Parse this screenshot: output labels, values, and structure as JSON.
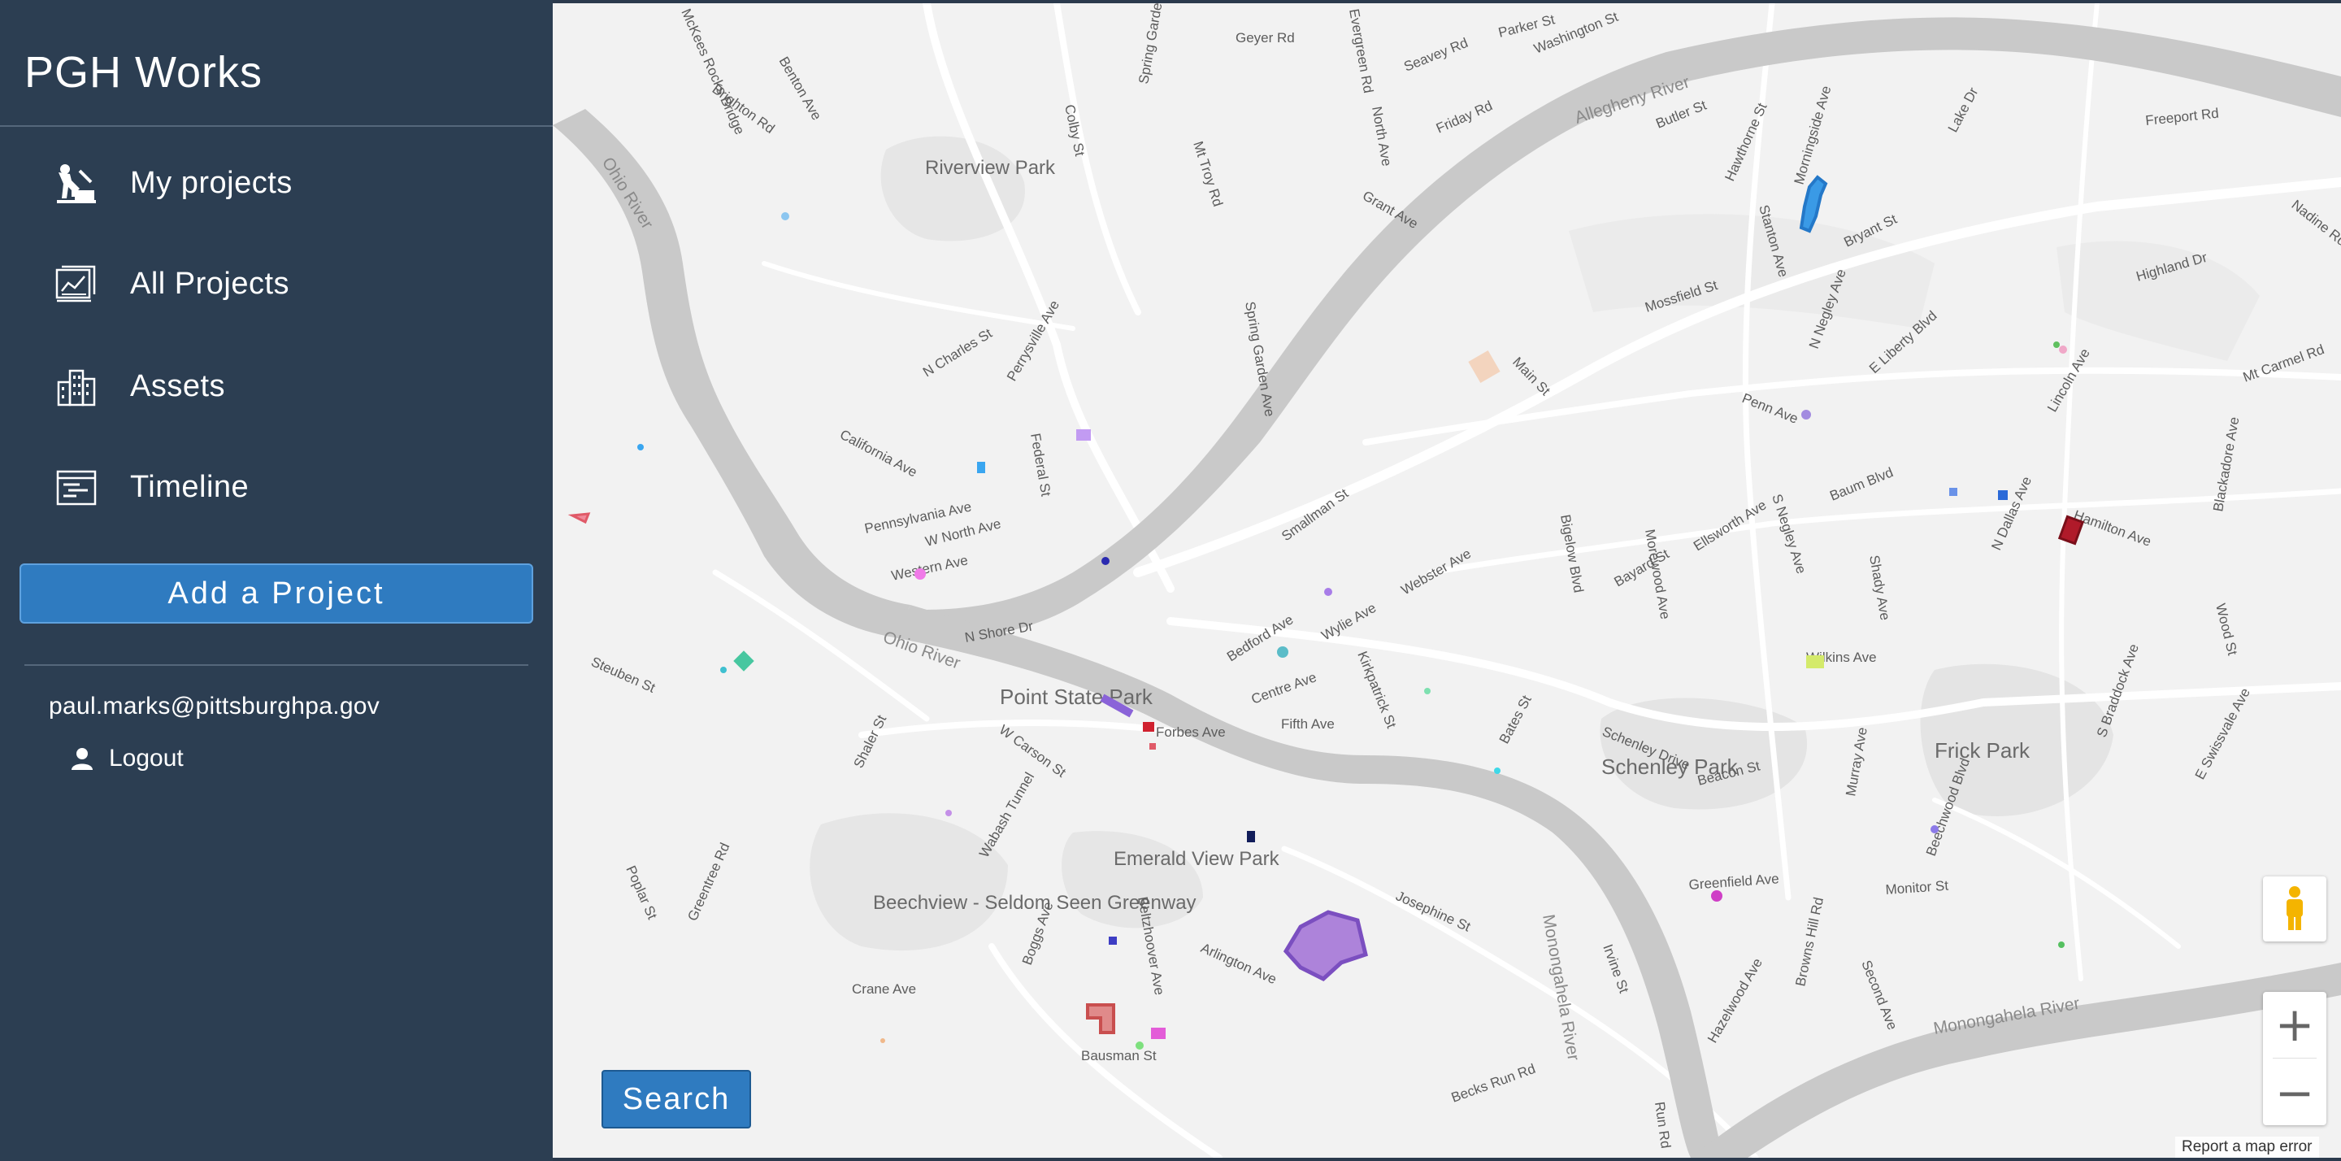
{
  "sidebar": {
    "brand": "PGH Works",
    "nav": [
      {
        "label": "My projects",
        "icon": "worker-icon"
      },
      {
        "label": "All Projects",
        "icon": "projects-chart-icon"
      },
      {
        "label": "Assets",
        "icon": "buildings-icon"
      },
      {
        "label": "Timeline",
        "icon": "timeline-icon"
      }
    ],
    "add_project_label": "Add a Project",
    "user_email": "paul.marks@pittsburghpa.gov",
    "logout_label": "Logout"
  },
  "map": {
    "search_label": "Search",
    "zoom_in_label": "+",
    "zoom_out_label": "−",
    "map_error_label": "Report a map error",
    "parks": [
      "Riverview Park",
      "Point State Park",
      "Emerald View Park",
      "Beechview - Seldom Seen Greenway",
      "Schenley Park",
      "Frick Park"
    ],
    "rivers": [
      "Ohio River",
      "Allegheny River",
      "Monongahela River"
    ],
    "streets": [
      "Geyer Rd",
      "Parker St",
      "Washington St",
      "Evergreen Rd",
      "Seavey Rd",
      "North Ave",
      "Friday Rd",
      "Grant Ave",
      "Benton Ave",
      "Brighton Rd",
      "Colby St",
      "Spring Garden Rd",
      "Mt Troy Rd",
      "Butler St",
      "Hawthorne St",
      "Morningside Ave",
      "Stanton Ave",
      "Bryant St",
      "Lake Dr",
      "Freeport Rd",
      "Nadine Rd",
      "Highland Dr",
      "Mossfield St",
      "N Negley Ave",
      "E Liberty Blvd",
      "Penn Ave",
      "Main St",
      "Spring Garden Ave",
      "N Charles St",
      "Perrysville Ave",
      "California Ave",
      "Federal St",
      "Pennsylvania Ave",
      "W North Ave",
      "Western Ave",
      "Smallman St",
      "Baum Blvd",
      "S Negley Ave",
      "Ellsworth Ave",
      "Bayard St",
      "Morewood Ave",
      "Bigelow Blvd",
      "Webster Ave",
      "Bedford Ave",
      "Wylie Ave",
      "N Shore Dr",
      "Kirkpatrick St",
      "Centre Ave",
      "Forbes Ave",
      "Fifth Ave",
      "Wilkins Ave",
      "Shady Ave",
      "Hamilton Ave",
      "N Dallas Ave",
      "Lincoln Ave",
      "Mt Carmel Rd",
      "Blackadore Ave",
      "Wood St",
      "S Braddock Ave",
      "E Swissvale Ave",
      "Steuben St",
      "Shaler St",
      "W Carson St",
      "Wabash Tunnel",
      "Poplar St",
      "Greentree Rd",
      "Boggs Ave",
      "Beltzhoover Ave",
      "Arlington Ave",
      "Josephine St",
      "Crane Ave",
      "Bausman St",
      "Becks Run Rd",
      "Schenley Drive",
      "Bates St",
      "Beacon St",
      "Murray Ave",
      "Beechwood Blvd",
      "Greenfield Ave",
      "Monitor St",
      "Irvine St",
      "Hazelwood Ave",
      "Browns Hill Rd",
      "Second Ave",
      "Run Rd",
      "McKees Rocks Bridge"
    ]
  },
  "colors": {
    "sidebar_bg": "#2c3e52",
    "accent_button": "#2f7bc0",
    "map_bg": "#f2f2f2",
    "river": "#c9c9c9"
  }
}
